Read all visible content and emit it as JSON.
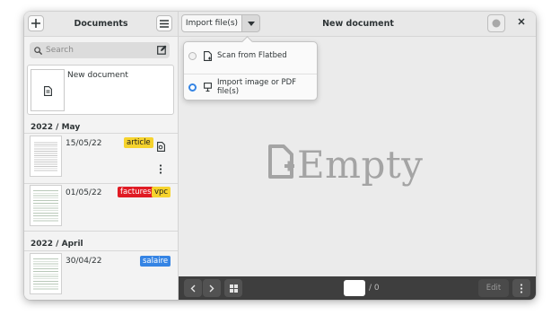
{
  "sidebar": {
    "title": "Documents",
    "search_placeholder": "Search",
    "new_document_label": "New document",
    "groups": [
      {
        "label": "2022 / May",
        "items": [
          {
            "date": "15/05/22",
            "tags": [
              {
                "label": "article",
                "color": "#f6d32d"
              }
            ]
          },
          {
            "date": "01/05/22",
            "tags": [
              {
                "label": "factures",
                "color": "#e01b24"
              },
              {
                "label": "vpc",
                "color": "#f6d32d"
              }
            ]
          }
        ]
      },
      {
        "label": "2022 / April",
        "items": [
          {
            "date": "30/04/22",
            "tags": [
              {
                "label": "salaire",
                "color": "#3584e4"
              }
            ]
          }
        ]
      }
    ]
  },
  "header": {
    "import_label": "Import file(s)",
    "title": "New document"
  },
  "import_menu": {
    "options": [
      {
        "label": "Scan from Flatbed",
        "selected": false
      },
      {
        "label": "Import image or PDF file(s)",
        "selected": true
      }
    ]
  },
  "empty_state": {
    "text": "Empty"
  },
  "bottom_bar": {
    "page_value": "",
    "page_total": "/ 0",
    "edit_label": "Edit"
  },
  "colors": {
    "accent": "#3584e4",
    "yellow_tag": "#f6d32d",
    "red_tag": "#e01b24"
  }
}
